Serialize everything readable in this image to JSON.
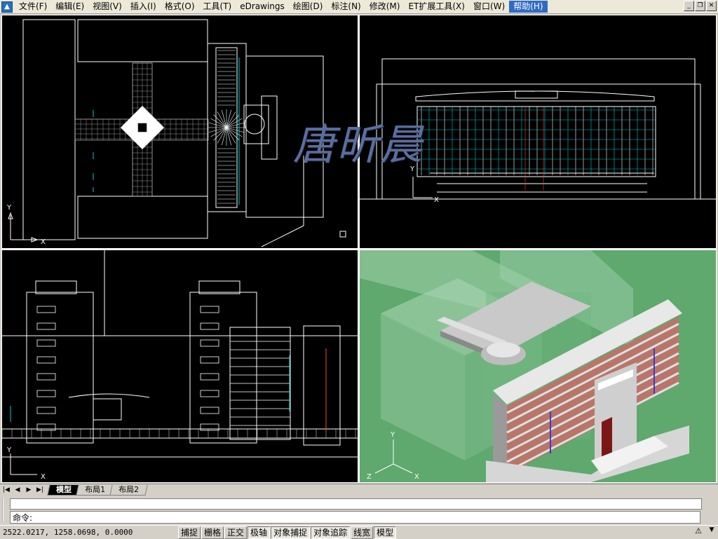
{
  "menu": {
    "items": [
      "文件(F)",
      "编辑(E)",
      "视图(V)",
      "插入(I)",
      "格式(O)",
      "工具(T)",
      "eDrawings",
      "绘图(D)",
      "标注(N)",
      "修改(M)",
      "ET扩展工具(X)",
      "窗口(W)",
      "帮助(H)"
    ],
    "active": "帮助(H)"
  },
  "window_buttons": {
    "minimize": "_",
    "restore": "❐",
    "close": "✕"
  },
  "watermark": "唐昕晨",
  "viewports": {
    "top_left": {
      "ucs_y": "Y",
      "ucs_x": "X"
    },
    "top_right": {
      "ucs_y": "Y",
      "ucs_x": "X"
    },
    "bottom_left": {
      "ucs_y": "Y",
      "ucs_x": "X"
    },
    "bottom_right": {
      "ucs_y": "Y",
      "ucs_x": "X",
      "ucs_z": "Z"
    }
  },
  "layout_tabs": {
    "nav": [
      "|◀",
      "◀",
      "▶",
      "▶|"
    ],
    "tabs": [
      "模型",
      "布局1",
      "布局2"
    ],
    "active": "模型"
  },
  "command": {
    "prompt": "命令:"
  },
  "status": {
    "coords": "2522.0217,  1258.0698, 0.0000",
    "buttons": [
      "捕捉",
      "栅格",
      "正交",
      "极轴",
      "对象捕捉",
      "对象追踪",
      "线宽",
      "模型"
    ]
  },
  "colors": {
    "model_bg": "#000000",
    "shaded_bg": "#5fa86e",
    "accent": "#316ac5"
  }
}
